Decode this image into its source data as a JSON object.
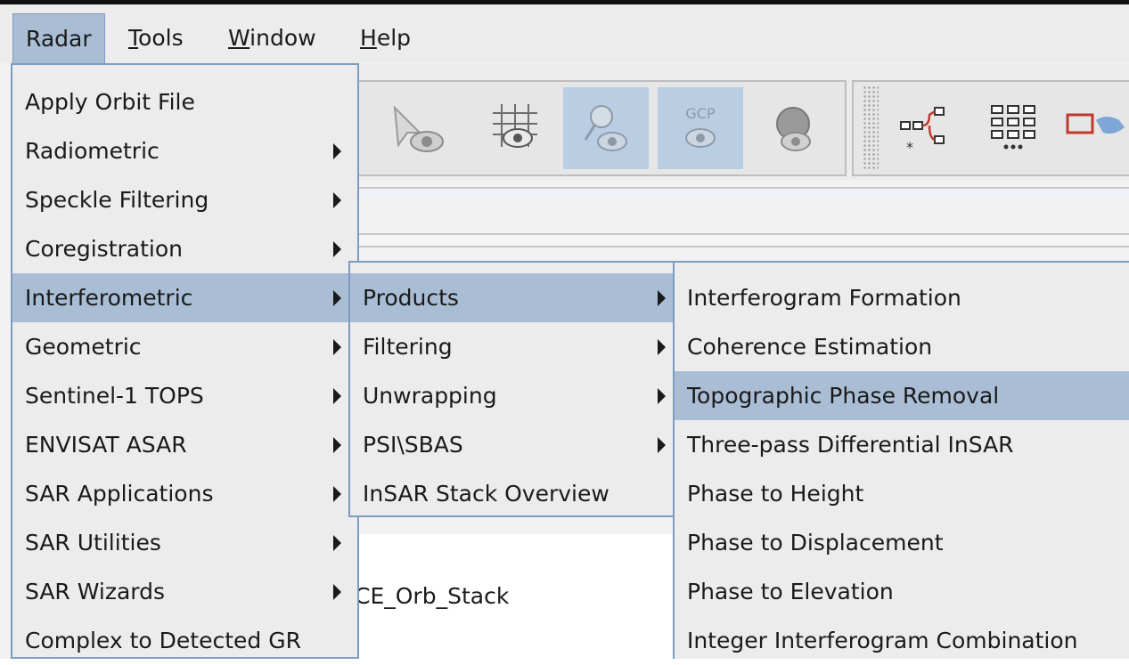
{
  "menubar": {
    "items": [
      {
        "label": "Radar",
        "mnemonic": ""
      },
      {
        "label": "ools",
        "mnemonic": "T"
      },
      {
        "label": "indow",
        "mnemonic": "W"
      },
      {
        "label": "elp",
        "mnemonic": "H"
      }
    ]
  },
  "background": {
    "graph_label": "CE_Orb_Stack"
  },
  "radar_menu": {
    "items": [
      {
        "label": "Apply Orbit File",
        "submenu": false
      },
      {
        "label": "Radiometric",
        "submenu": true
      },
      {
        "label": "Speckle Filtering",
        "submenu": true
      },
      {
        "label": "Coregistration",
        "submenu": true
      },
      {
        "label": "Interferometric",
        "submenu": true
      },
      {
        "label": "Geometric",
        "submenu": true
      },
      {
        "label": "Sentinel-1 TOPS",
        "submenu": true
      },
      {
        "label": "ENVISAT ASAR",
        "submenu": true
      },
      {
        "label": "SAR Applications",
        "submenu": true
      },
      {
        "label": "SAR Utilities",
        "submenu": true
      },
      {
        "label": "SAR Wizards",
        "submenu": true
      },
      {
        "label": "Complex to Detected GR",
        "submenu": false
      }
    ]
  },
  "interferometric_menu": {
    "items": [
      {
        "label": "Products",
        "submenu": true
      },
      {
        "label": "Filtering",
        "submenu": true
      },
      {
        "label": "Unwrapping",
        "submenu": true
      },
      {
        "label": "PSI\\SBAS",
        "submenu": true
      },
      {
        "label": "InSAR Stack Overview",
        "submenu": false
      }
    ]
  },
  "products_menu": {
    "items": [
      {
        "label": "Interferogram Formation"
      },
      {
        "label": "Coherence Estimation"
      },
      {
        "label": "Topographic Phase Removal"
      },
      {
        "label": "Three-pass Differential InSAR"
      },
      {
        "label": "Phase to Height"
      },
      {
        "label": "Phase to Displacement"
      },
      {
        "label": "Phase to Elevation"
      },
      {
        "label": "Integer Interferogram Combination"
      }
    ]
  },
  "toolbar": {
    "gcp_label": "GCP"
  },
  "colors": {
    "highlight": "#a9bdd5",
    "menu_bg": "#ececec",
    "menu_border": "#7f9bbf"
  }
}
